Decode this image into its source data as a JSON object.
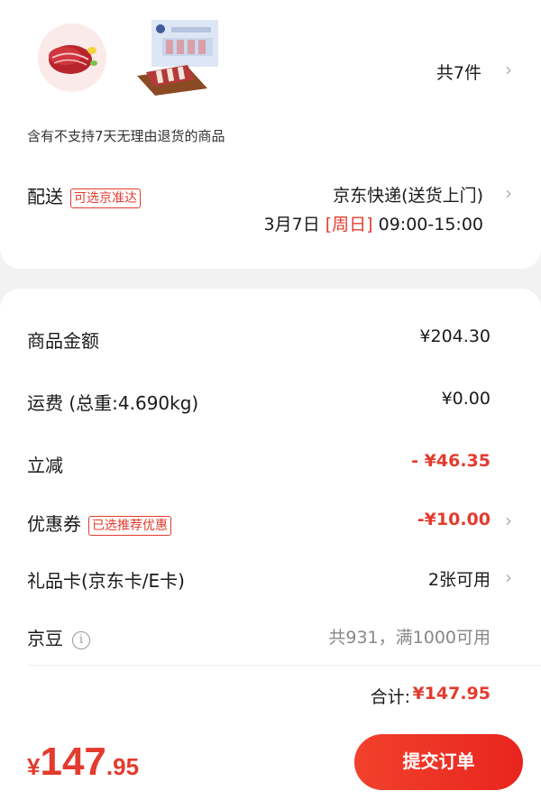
{
  "order": {
    "item_count": "共7件",
    "return_notice": "含有不支持7天无理由退货的商品"
  },
  "delivery": {
    "label": "配送",
    "tag": "可选京准达",
    "method": "京东快递(送货上门)",
    "date": "3月7日",
    "weekday": "[周日]",
    "time": "09:00-15:00"
  },
  "summary": {
    "goods_label": "商品金额",
    "goods_value": "¥204.30",
    "shipping_label": "运费 (总重:4.690kg)",
    "shipping_value": "¥0.00",
    "discount_label": "立减",
    "discount_value": "- ¥46.35",
    "coupon_label": "优惠券",
    "coupon_tag": "已选推荐优惠",
    "coupon_value": "-¥10.00",
    "giftcard_label": "礼品卡(京东卡/E卡)",
    "giftcard_value": "2张可用",
    "jingdou_label": "京豆",
    "jingdou_value": "共931，满1000可用",
    "total_label": "合计:",
    "total_value": "¥147.95"
  },
  "bottom_bar": {
    "currency": "¥",
    "price_int": "147",
    "price_dec": ".95",
    "submit_label": "提交订单"
  },
  "icons": {
    "chevron": "chevron-right-icon",
    "info": "info-icon"
  },
  "colors": {
    "accent": "#e33b2e",
    "background": "#f2f2f2"
  }
}
